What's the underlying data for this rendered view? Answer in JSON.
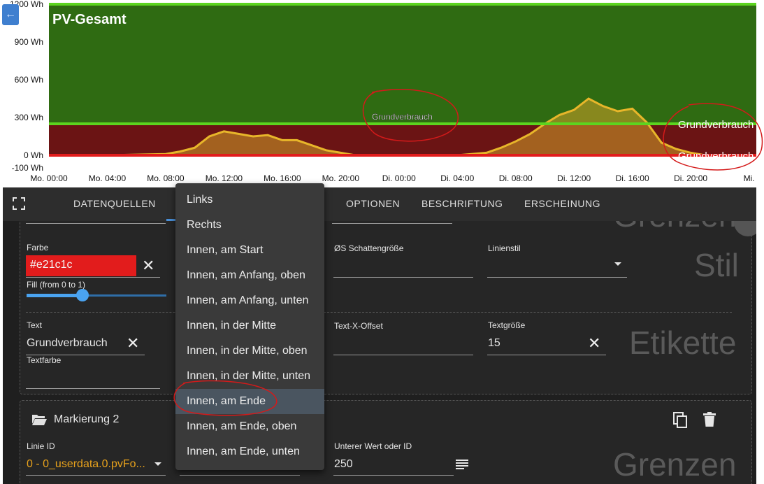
{
  "chart": {
    "title": "PV-Gesamt",
    "y_ticks": [
      "1200 Wh",
      "900 Wh",
      "600 Wh",
      "300 Wh",
      "0 Wh",
      "-100 Wh"
    ],
    "x_ticks": [
      "Mo. 00:00",
      "Mo. 04:00",
      "Mo. 08:00",
      "Mo. 12:00",
      "Mo. 16:00",
      "Mo. 20:00",
      "Di. 00:00",
      "Di. 04:00",
      "Di. 08:00",
      "Di. 12:00",
      "Di. 16:00",
      "Di. 20:00",
      "Mi."
    ],
    "preview_label": "Grundverbrauch",
    "mark_labels": [
      "Grundverbrauch",
      "Grundverbrauch"
    ],
    "colors": {
      "green_band": "#2f6b12",
      "red_band": "#6b1414",
      "line": "#e8b62a",
      "green_line": "#5cd41f",
      "red_line": "#e21c1c"
    }
  },
  "chart_data": {
    "type": "area",
    "ylim": [
      -100,
      1200
    ],
    "marks": [
      {
        "name": "Grundverbrauch",
        "value": 250,
        "color": "#5cd41f"
      },
      {
        "name": "Grundverbrauch",
        "value": 0,
        "color": "#e21c1c"
      }
    ],
    "top_line": 1200,
    "x_hours": [
      0,
      4,
      8,
      9,
      10,
      11,
      12,
      13,
      14,
      15,
      16,
      17,
      18,
      19,
      20,
      21,
      22,
      23,
      24,
      28,
      30,
      31,
      32,
      33,
      34,
      35,
      36,
      37,
      38,
      39,
      40,
      41,
      42,
      43,
      44,
      45,
      46,
      47,
      48
    ],
    "values": [
      0,
      0,
      10,
      30,
      60,
      150,
      190,
      170,
      150,
      160,
      120,
      120,
      80,
      40,
      20,
      0,
      0,
      0,
      0,
      0,
      20,
      60,
      110,
      170,
      250,
      320,
      360,
      450,
      390,
      350,
      370,
      260,
      100,
      50,
      20,
      0,
      0,
      0,
      0
    ]
  },
  "tabs": [
    "Datenquellen",
    "",
    "Optionen",
    "Beschriftung",
    "Erscheinung"
  ],
  "style_section": {
    "farbe_label": "Farbe",
    "farbe_value": "#e21c1c",
    "fill_label": "Fill (from 0 to 1)",
    "fill_value": 0.4,
    "shadow_label": "ØS Schattengröße",
    "linestyle_label": "Linienstil",
    "watermark": "Stil",
    "top_watermark": "Grenzen"
  },
  "label_section": {
    "text_label": "Text",
    "text_value": "Grundverbrauch",
    "textcolor_label": "Textfarbe",
    "xoffset_label": "Text-X-Offset",
    "size_label": "Textgröße",
    "size_value": "15",
    "watermark": "Etikette"
  },
  "mark2": {
    "title": "Markierung 2",
    "line_id_label": "Linie ID",
    "line_id_value": "0 - 0_userdata.0.pvFo...",
    "lower_label": "Unterer Wert oder ID",
    "lower_value": "250",
    "watermark": "Grenzen"
  },
  "dropdown": {
    "items": [
      "Links",
      "Rechts",
      "Innen, am Start",
      "Innen, am Anfang, oben",
      "Innen, am Anfang, unten",
      "Innen, in der Mitte",
      "Innen, in der Mitte, oben",
      "Innen, in der Mitte, unten",
      "Innen, am Ende",
      "Innen, am Ende, oben",
      "Innen, am Ende, unten"
    ],
    "selected_index": 8
  }
}
